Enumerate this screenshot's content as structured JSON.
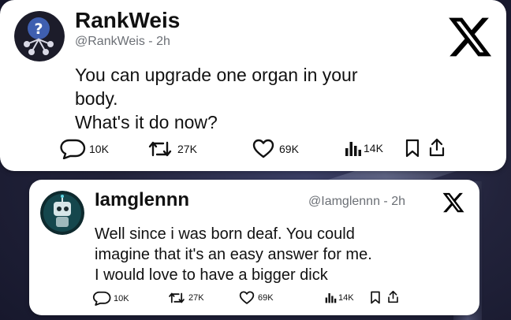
{
  "post": {
    "author_name": "RankWeis",
    "handle_time": "@RankWeis - 2h",
    "text_lines": [
      "You can upgrade one organ in your",
      "body.",
      "What's it do now?"
    ],
    "stats": {
      "replies": "10K",
      "reposts": "27K",
      "likes": "69K",
      "views": "14K"
    },
    "icons": [
      "x-logo-icon",
      "reply-icon",
      "repost-icon",
      "like-icon",
      "views-icon",
      "bookmark-icon",
      "share-icon"
    ]
  },
  "reply": {
    "author_name": "Iamglennn",
    "handle_time": "@Iamglennn - 2h",
    "text_lines": [
      "Well since i was born deaf. You could",
      "imagine that it's an easy answer for me.",
      "I would love to have a bigger dick"
    ],
    "stats": {
      "replies": "10K",
      "reposts": "27K",
      "likes": "69K",
      "views": "14K"
    }
  },
  "colors": {
    "card_bg": "#ffffff",
    "text": "#111111",
    "muted": "#6b6f75"
  }
}
